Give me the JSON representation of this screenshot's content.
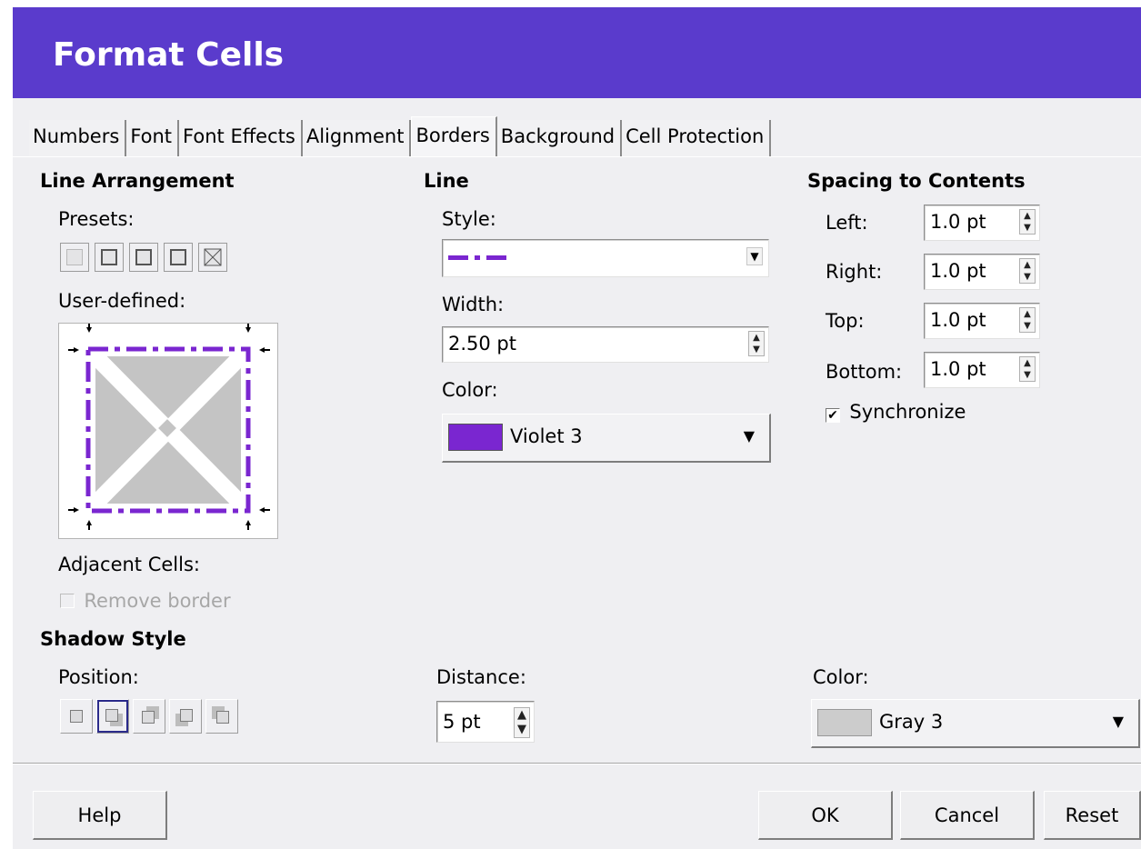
{
  "window": {
    "title": "Format Cells"
  },
  "tabs": [
    "Numbers",
    "Font",
    "Font Effects",
    "Alignment",
    "Borders",
    "Background",
    "Cell Protection"
  ],
  "line_arrangement": {
    "heading": "Line Arrangement",
    "presets_label": "Presets:",
    "user_defined_label": "User-defined:",
    "adjacent_cells_label": "Adjacent Cells:",
    "remove_border_label": "Remove border",
    "remove_border_checked": false
  },
  "line": {
    "heading": "Line",
    "style_label": "Style:",
    "width_label": "Width:",
    "width_value": "2.50 pt",
    "color_label": "Color:",
    "color_value": "Violet 3",
    "color_hex": "#7a26d0"
  },
  "spacing": {
    "heading": "Spacing to Contents",
    "left_label": "Left:",
    "left_value": "1.0 pt",
    "right_label": "Right:",
    "right_value": "1.0 pt",
    "top_label": "Top:",
    "top_value": "1.0 pt",
    "bottom_label": "Bottom:",
    "bottom_value": "1.0 pt",
    "synchronize_label": "Synchronize",
    "synchronize_checked": true
  },
  "shadow": {
    "heading": "Shadow Style",
    "position_label": "Position:",
    "distance_label": "Distance:",
    "distance_value": "5 pt",
    "color_label": "Color:",
    "color_value": "Gray 3",
    "color_hex": "#cccccc"
  },
  "buttons": {
    "help": "Help",
    "ok": "OK",
    "cancel": "Cancel",
    "reset": "Reset"
  },
  "colors": {
    "titlebar": "#5a3bcc",
    "border_line": "#7a26d0"
  }
}
